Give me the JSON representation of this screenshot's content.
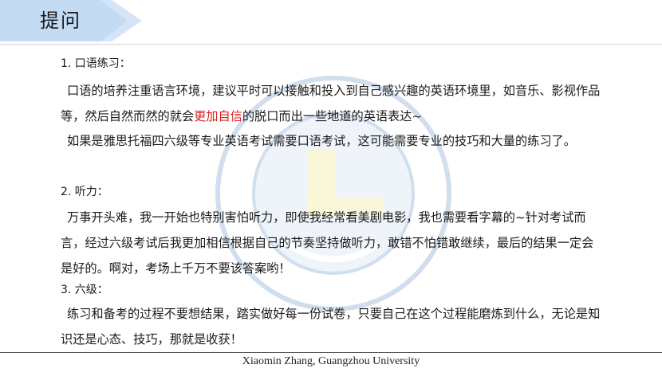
{
  "title": "提问",
  "sections": [
    {
      "heading": "1. 口语练习：",
      "paragraphs": [
        {
          "before": "口语的培养注重语言环境，建议平时可以接触和投入到自己感兴趣的英语环境里，如音乐、影视作品等，然后自然而然的就会",
          "highlight": "更加自信",
          "after": "的脱口而出一些地道的英语表达~"
        },
        {
          "text": "如果是雅思托福四六级等专业英语考试需要口语考试，这可能需要专业的技巧和大量的练习了。"
        }
      ]
    },
    {
      "heading": "2. 听力：",
      "paragraphs": [
        {
          "text": "万事开头难，我一开始也特别害怕听力，即使我经常看美剧电影，我也需要看字幕的~针对考试而言，经过六级考试后我更加相信根据自己的节奏坚持做听力，敢错不怕错敢继续，最后的结果一定会是好的。啊对，考场上千万不要该答案哟！"
        }
      ]
    },
    {
      "heading": "3. 六级：",
      "paragraphs": [
        {
          "text": "练习和备考的过程不要想结果，踏实做好每一份试卷，只要自己在这个过程能磨炼到什么，无论是知识还是心态、技巧，那就是收获！"
        }
      ]
    }
  ],
  "footer": "Xiaomin Zhang, Guangzhou University",
  "colors": {
    "title_band": "#c4dbf4",
    "highlight": "#e0201f",
    "watermark": "#2f6fb5"
  },
  "watermark_icon": "university-seal-icon"
}
